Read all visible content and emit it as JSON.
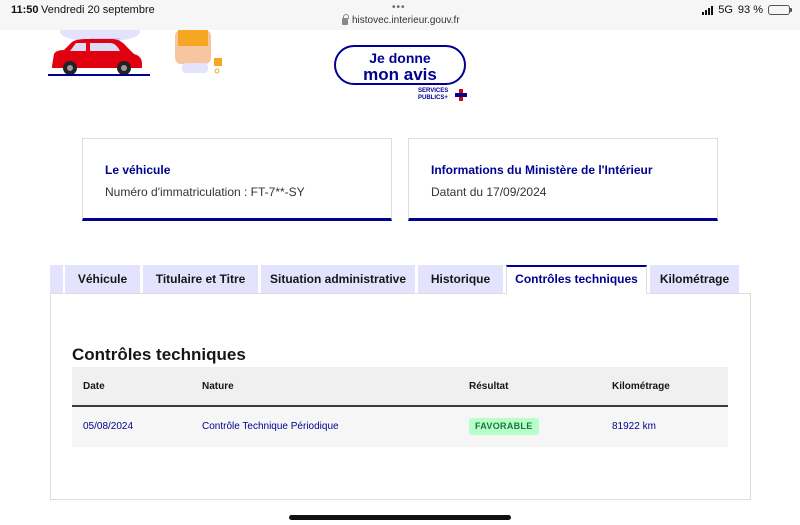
{
  "statusbar": {
    "time": "11:50",
    "date": "Vendredi 20 septembre",
    "url": "histovec.interieur.gouv.fr",
    "network": "5G",
    "battery": "93 %",
    "battery_level": 0.93
  },
  "avis": {
    "line1": "Je donne",
    "line2": "mon avis",
    "logo_line1": "SERVICES",
    "logo_line2": "PUBLICS+"
  },
  "cards": {
    "vehicle": {
      "title": "Le véhicule",
      "text": "Numéro d'immatriculation : FT-7**-SY"
    },
    "ministry": {
      "title": "Informations du Ministère de l'Intérieur",
      "text": "Datant du 17/09/2024"
    }
  },
  "tabs": [
    {
      "label": "Véhicule"
    },
    {
      "label": "Titulaire et Titre"
    },
    {
      "label": "Situation administrative"
    },
    {
      "label": "Historique"
    },
    {
      "label": "Contrôles techniques"
    },
    {
      "label": "Kilométrage"
    }
  ],
  "active_tab": "Contrôles techniques",
  "panel": {
    "title": "Contrôles techniques",
    "columns": [
      "Date",
      "Nature",
      "Résultat",
      "Kilométrage"
    ],
    "rows": [
      {
        "date": "05/08/2024",
        "nature": "Contrôle Technique Périodique",
        "result": "FAVORABLE",
        "km": "81922 km"
      }
    ]
  },
  "colors": {
    "primary": "#000091",
    "tab_bg": "#e3e3fd",
    "badge_bg": "#b8fec9",
    "badge_text": "#18753c"
  }
}
